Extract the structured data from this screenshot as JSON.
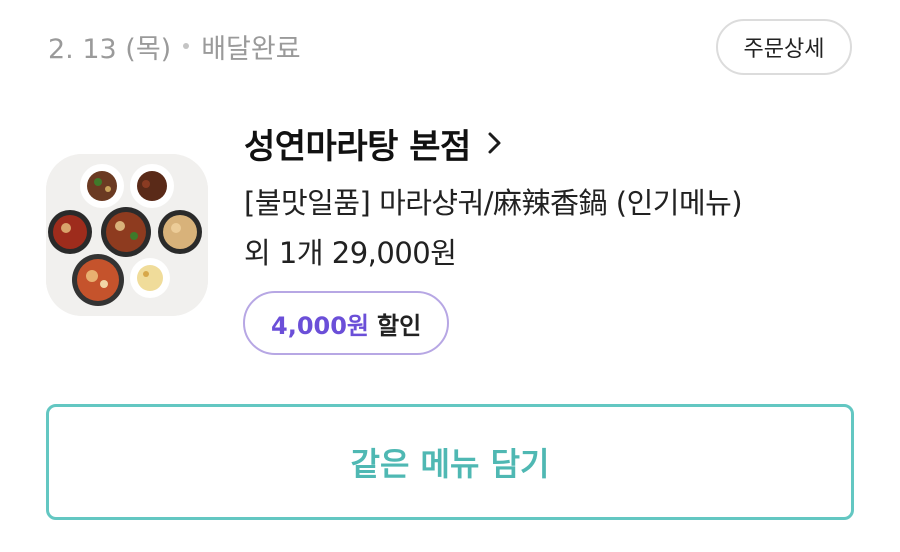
{
  "order": {
    "date": "2. 13 (목)",
    "status": "배달완료",
    "detail_label": "주문상세"
  },
  "store": {
    "name": "성연마라탕 본점"
  },
  "menu": {
    "line1": "[불맛일품] 마라샹궈/麻辣香鍋 (인기메뉴)",
    "line2": "외 1개 29,000원"
  },
  "discount": {
    "amount": "4,000원",
    "label": "할인"
  },
  "actions": {
    "reorder_label": "같은 메뉴 담기"
  },
  "icons": {
    "store_chevron": "chevron-right-icon",
    "food_thumbnail": "food-dish-image"
  },
  "colors": {
    "accent_teal": "#4fb8b3",
    "discount_purple": "#6b4fd8",
    "muted_gray": "#9a9a9a"
  }
}
